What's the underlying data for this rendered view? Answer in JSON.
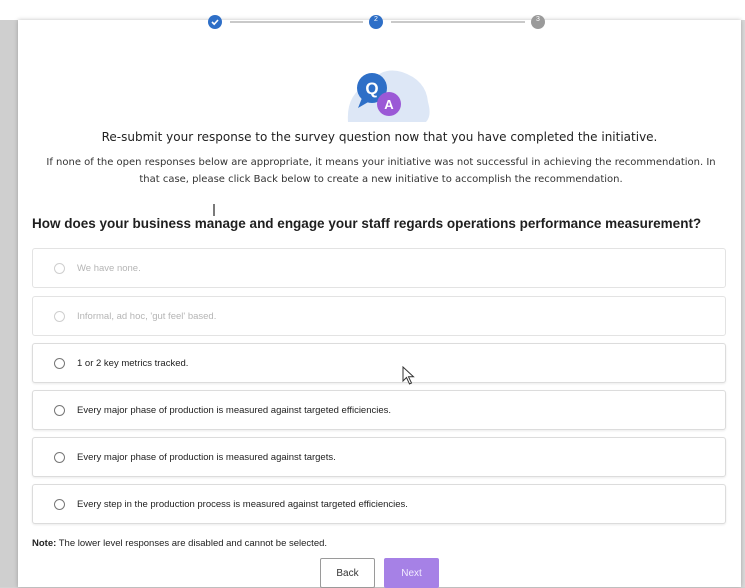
{
  "stepper": {
    "steps": [
      {
        "state": "completed",
        "icon": "check-icon"
      },
      {
        "state": "current",
        "number": "2"
      },
      {
        "state": "upcoming",
        "number": "3"
      }
    ],
    "colors": {
      "active": "#2e6fc7",
      "inactive": "#9a9a9a"
    }
  },
  "illustration": {
    "q_letter": "Q",
    "a_letter": "A"
  },
  "heading": "Re-submit your response to the survey question now that you have completed the initiative.",
  "instructions": "If none of the open responses below are appropriate, it means your initiative was not successful in achieving the recommendation. In that case, please click Back below to create a new initiative to accomplish the recommendation.",
  "question": "How does your business manage and engage your staff regards operations performance measurement?",
  "options": [
    {
      "label": "We have none.",
      "disabled": true
    },
    {
      "label": "Informal, ad hoc, 'gut feel' based.",
      "disabled": true
    },
    {
      "label": "1 or 2 key metrics tracked.",
      "disabled": false
    },
    {
      "label": "Every major phase of production is measured against targeted efficiencies.",
      "disabled": false
    },
    {
      "label": "Every major phase of production is measured against targets.",
      "disabled": false
    },
    {
      "label": "Every step in the production process is measured against targeted efficiencies.",
      "disabled": false
    }
  ],
  "note": {
    "prefix": "Note:",
    "text": " The lower level responses are disabled and cannot be selected."
  },
  "buttons": {
    "back": "Back",
    "next": "Next"
  },
  "accent": "#a681e6"
}
